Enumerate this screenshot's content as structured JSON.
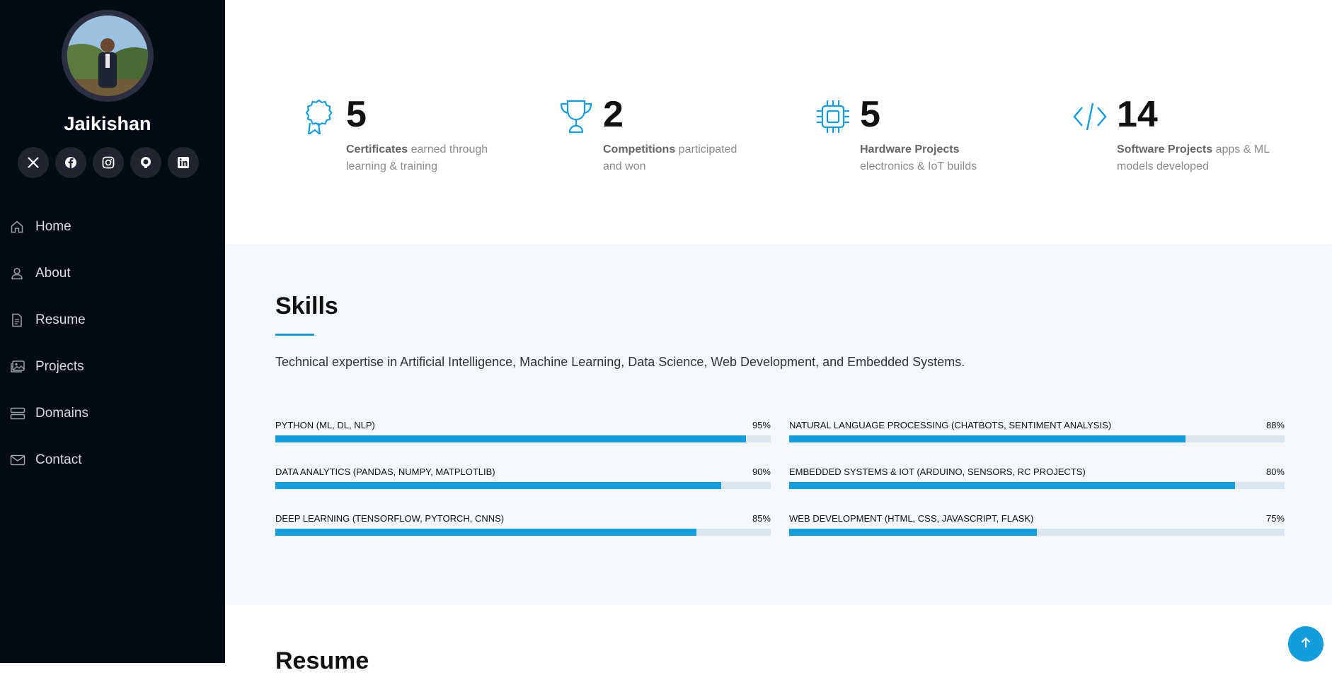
{
  "profile": {
    "name": "Jaikishan",
    "avatar_icon": "profile-photo"
  },
  "socials": [
    {
      "name": "x-twitter-icon"
    },
    {
      "name": "facebook-icon"
    },
    {
      "name": "instagram-icon"
    },
    {
      "name": "github-icon"
    },
    {
      "name": "linkedin-icon"
    }
  ],
  "nav": [
    {
      "label": "Home",
      "icon": "house-icon"
    },
    {
      "label": "About",
      "icon": "person-icon"
    },
    {
      "label": "Resume",
      "icon": "file-icon"
    },
    {
      "label": "Projects",
      "icon": "images-icon"
    },
    {
      "label": "Domains",
      "icon": "server-icon"
    },
    {
      "label": "Contact",
      "icon": "envelope-icon"
    }
  ],
  "stats": [
    {
      "number": "5",
      "bold": "Certificates",
      "text": " earned through learning & training",
      "icon": "award-icon"
    },
    {
      "number": "2",
      "bold": "Competitions",
      "text": " participated and won",
      "icon": "trophy-icon"
    },
    {
      "number": "5",
      "bold": "Hardware Projects",
      "text": " electronics & IoT builds",
      "icon": "cpu-icon"
    },
    {
      "number": "14",
      "bold": "Software Projects",
      "text": " apps & ML models developed",
      "icon": "code-icon"
    }
  ],
  "skills": {
    "title": "Skills",
    "description": "Technical expertise in Artificial Intelligence, Machine Learning, Data Science, Web Development, and Embedded Systems.",
    "items": [
      {
        "label": "Python (ML, DL, NLP)",
        "percent": 95,
        "display": "95%"
      },
      {
        "label": "Natural Language Processing (Chatbots, Sentiment Analysis)",
        "percent": 80,
        "display": "88%"
      },
      {
        "label": "Data Analytics (Pandas, NumPy, Matplotlib)",
        "percent": 90,
        "display": "90%"
      },
      {
        "label": "Embedded Systems & IoT (Arduino, Sensors, RC Projects)",
        "percent": 90,
        "display": "80%"
      },
      {
        "label": "Deep Learning (TensorFlow, PyTorch, CNNs)",
        "percent": 85,
        "display": "85%"
      },
      {
        "label": "Web Development (HTML, CSS, JavaScript, Flask)",
        "percent": 50,
        "display": "75%"
      }
    ]
  },
  "next_section": {
    "title": "Resume"
  },
  "colors": {
    "accent": "#149ddd",
    "sidebar": "#040b14"
  }
}
